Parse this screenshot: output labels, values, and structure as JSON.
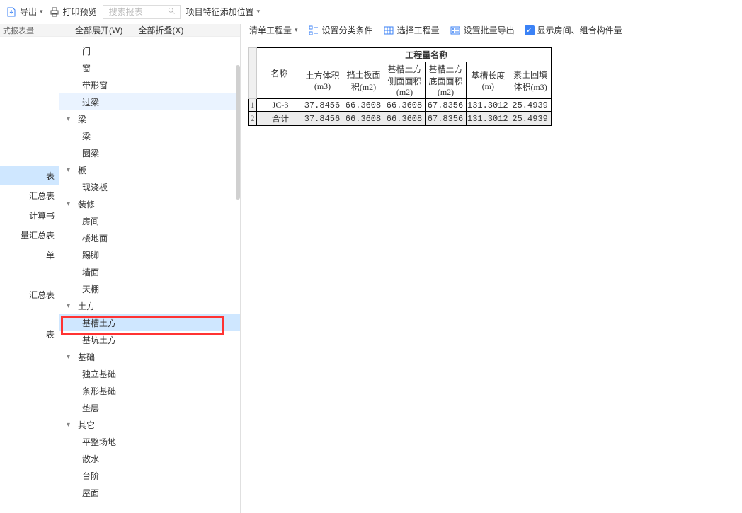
{
  "topbar": {
    "export_label": "导出",
    "print_preview_label": "打印预览",
    "search_placeholder": "搜索报表",
    "feature_pos_label": "项目特征添加位置"
  },
  "leftcol": {
    "tab": "式报表量",
    "items": [
      {
        "label": "表",
        "selected": true
      },
      {
        "label": "汇总表"
      },
      {
        "label": "计算书"
      },
      {
        "label": "量汇总表"
      },
      {
        "label": "单"
      },
      {
        "label": ""
      },
      {
        "label": "汇总表"
      },
      {
        "label": ""
      },
      {
        "label": "表"
      }
    ]
  },
  "tree": {
    "expand_all": "全部展开(W)",
    "collapse_all": "全部折叠(X)",
    "groups": [
      {
        "label": "",
        "children": [
          "门",
          "窗",
          "带形窗",
          "过梁"
        ],
        "hidden_header": true,
        "highlight_child": 3
      },
      {
        "label": "梁",
        "children": [
          "梁",
          "圈梁"
        ]
      },
      {
        "label": "板",
        "children": [
          "现浇板"
        ]
      },
      {
        "label": "装修",
        "children": [
          "房间",
          "楼地面",
          "踢脚",
          "墙面",
          "天棚"
        ]
      },
      {
        "label": "土方",
        "children": [
          "基槽土方",
          "基坑土方"
        ],
        "selected_child": 0
      },
      {
        "label": "基础",
        "children": [
          "独立基础",
          "条形基础",
          "垫层"
        ]
      },
      {
        "label": "其它",
        "children": [
          "平整场地",
          "散水",
          "台阶",
          "屋面"
        ]
      }
    ]
  },
  "right_tools": {
    "list_quantity": "清单工程量",
    "classify": "设置分类条件",
    "select_qty": "选择工程量",
    "batch_export": "设置批量导出",
    "show_rooms": "显示房间、组合构件量"
  },
  "chart_data": {
    "type": "table",
    "title_top": "工程量名称",
    "row_header": "名称",
    "columns": [
      "土方体积(m3)",
      "挡土板面积(m2)",
      "基槽土方侧面面积(m2)",
      "基槽土方底面面积(m2)",
      "基槽长度(m)",
      "素土回填体积(m3)"
    ],
    "rows": [
      {
        "name": "JC-3",
        "values": [
          "37.8456",
          "66.3608",
          "66.3608",
          "67.8356",
          "131.3012",
          "25.4939"
        ]
      },
      {
        "name": "合计",
        "values": [
          "37.8456",
          "66.3608",
          "66.3608",
          "67.8356",
          "131.3012",
          "25.4939"
        ]
      }
    ]
  }
}
